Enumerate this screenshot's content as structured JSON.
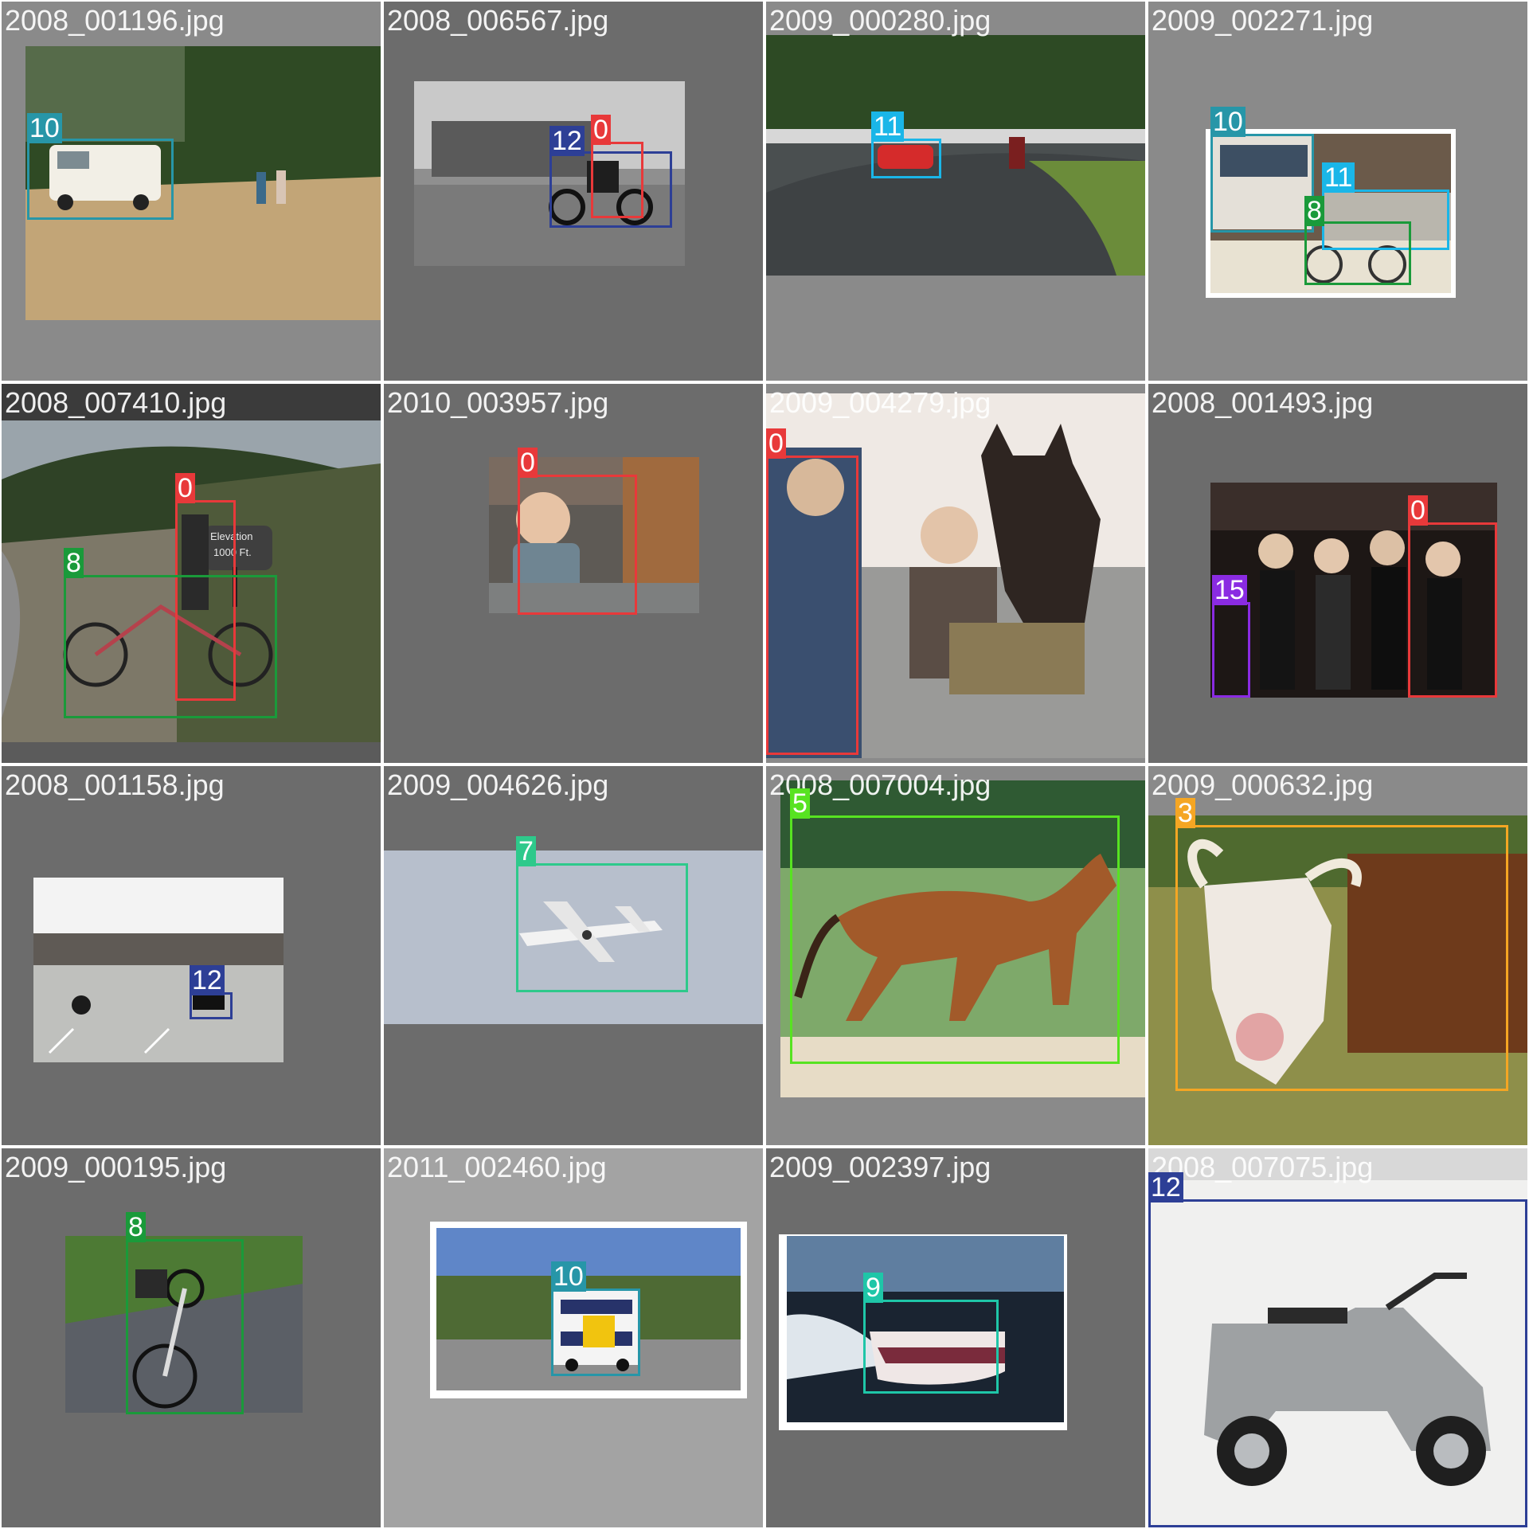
{
  "grid": {
    "columns": 4,
    "rows": 4
  },
  "class_colors": {
    "0": "#e8393a",
    "3": "#f5a623",
    "5": "#57e321",
    "7": "#2ec98b",
    "8": "#1a9a3a",
    "9": "#1fc6a8",
    "10": "#2796a8",
    "11": "#1ab6e8",
    "12": "#2d3f96",
    "15": "#8a2be2"
  },
  "tiles": [
    {
      "filename": "2008_001196.jpg",
      "scene": "camper-van-forest",
      "boxes": [
        {
          "class_id": "10"
        }
      ]
    },
    {
      "filename": "2008_006567.jpg",
      "scene": "motorcyclist-street-bw",
      "boxes": [
        {
          "class_id": "12"
        },
        {
          "class_id": "0"
        }
      ]
    },
    {
      "filename": "2009_000280.jpg",
      "scene": "race-track-car",
      "boxes": [
        {
          "class_id": "11"
        }
      ]
    },
    {
      "filename": "2009_002271.jpg",
      "scene": "bus-street-bicycle",
      "boxes": [
        {
          "class_id": "10"
        },
        {
          "class_id": "11"
        },
        {
          "class_id": "8"
        }
      ]
    },
    {
      "filename": "2008_007410.jpg",
      "scene": "cyclist-hillside",
      "sign_text": [
        "Elevation",
        "1000 Ft."
      ],
      "boxes": [
        {
          "class_id": "0"
        },
        {
          "class_id": "8"
        }
      ]
    },
    {
      "filename": "2010_003957.jpg",
      "scene": "baby-chair",
      "boxes": [
        {
          "class_id": "0"
        }
      ]
    },
    {
      "filename": "2009_004279.jpg",
      "scene": "people-horse",
      "boxes": [
        {
          "class_id": "0"
        }
      ]
    },
    {
      "filename": "2008_001493.jpg",
      "scene": "women-party",
      "boxes": [
        {
          "class_id": "15"
        },
        {
          "class_id": "0"
        }
      ]
    },
    {
      "filename": "2008_001158.jpg",
      "scene": "motorcycle-parking-lot",
      "boxes": [
        {
          "class_id": "12"
        }
      ]
    },
    {
      "filename": "2009_004626.jpg",
      "scene": "airplane-sky",
      "boxes": [
        {
          "class_id": "7"
        }
      ]
    },
    {
      "filename": "2008_007004.jpg",
      "scene": "horse-running",
      "boxes": [
        {
          "class_id": "5"
        }
      ]
    },
    {
      "filename": "2009_000632.jpg",
      "scene": "cow-field",
      "boxes": [
        {
          "class_id": "3"
        }
      ]
    },
    {
      "filename": "2009_000195.jpg",
      "scene": "bicycle-path",
      "boxes": [
        {
          "class_id": "8"
        }
      ]
    },
    {
      "filename": "2011_002460.jpg",
      "scene": "double-decker-bus",
      "boxes": [
        {
          "class_id": "10"
        }
      ]
    },
    {
      "filename": "2009_002397.jpg",
      "scene": "speedboat-sea",
      "boxes": [
        {
          "class_id": "9"
        }
      ]
    },
    {
      "filename": "2008_007075.jpg",
      "scene": "vintage-scooter-motorcycle",
      "boxes": [
        {
          "class_id": "12"
        }
      ]
    }
  ]
}
